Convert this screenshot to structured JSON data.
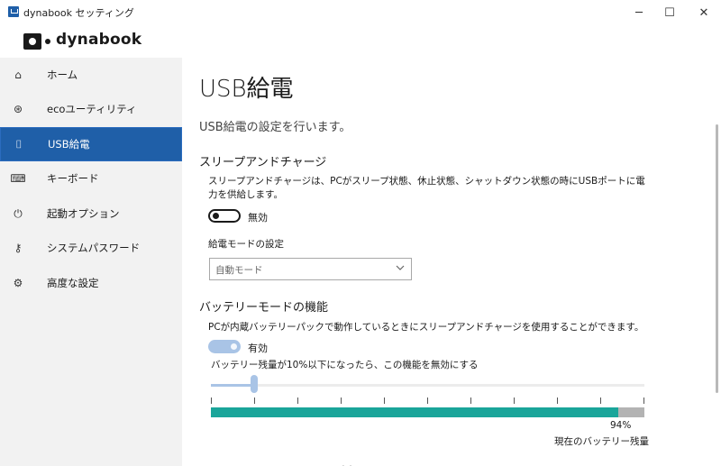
{
  "window": {
    "title": "dynabook セッティング",
    "minimize": "─",
    "maximize": "☐",
    "close": "✕"
  },
  "brand": {
    "name": "dynabook"
  },
  "sidebar": {
    "items": [
      {
        "label": "ホーム",
        "icon": "home-icon",
        "glyph": "⌂",
        "active": false
      },
      {
        "label": "ecoユーティリティ",
        "icon": "eco-icon",
        "glyph": "⊛",
        "active": false
      },
      {
        "label": "USB給電",
        "icon": "usb-plug-icon",
        "glyph": "⌷",
        "active": true
      },
      {
        "label": "キーボード",
        "icon": "keyboard-icon",
        "glyph": "⌨",
        "active": false
      },
      {
        "label": "起動オプション",
        "icon": "power-icon",
        "glyph": "⏻",
        "active": false
      },
      {
        "label": "システムパスワード",
        "icon": "key-icon",
        "glyph": "⚷",
        "active": false
      },
      {
        "label": "高度な設定",
        "icon": "gear-icon",
        "glyph": "⚙",
        "active": false
      }
    ],
    "active_color": "#1f5fa8"
  },
  "main": {
    "title": "USB給電",
    "description": "USB給電の設定を行います。",
    "sleep_charge": {
      "heading": "スリープアンドチャージ",
      "text": "スリープアンドチャージは、PCがスリープ状態、休止状態、シャットダウン状態の時にUSBポートに電力を供給します。",
      "toggle_state": "off",
      "toggle_label": "無効",
      "mode_label": "給電モードの設定",
      "mode_value": "自動モード"
    },
    "battery_mode": {
      "heading": "バッテリーモードの機能",
      "text": "PCが内蔵バッテリーパックで動作しているときにスリープアンドチャージを使用することができます。",
      "toggle_state": "on",
      "toggle_label": "有効",
      "threshold_text": "バッテリー残量が10%以下になったら、この機能を無効にする",
      "threshold_percent": 10,
      "tick_count": 11
    },
    "battery": {
      "percent_label": "94%",
      "percent": 94,
      "caption": "現在のバッテリー残量",
      "fill_color": "#1aa59a"
    },
    "peek_text": "～ ・ ° °"
  }
}
